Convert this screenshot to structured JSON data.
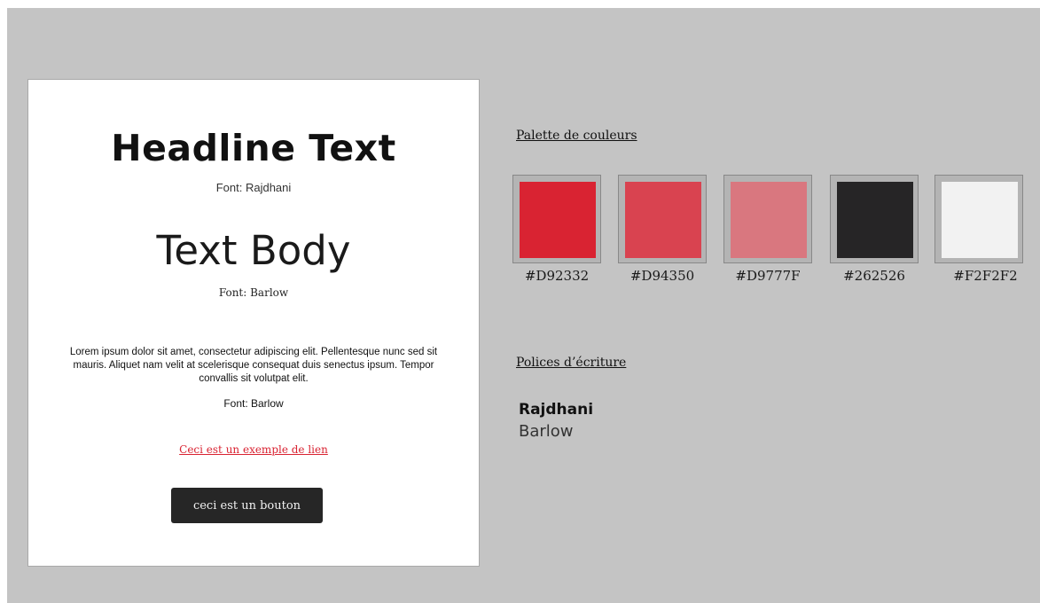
{
  "card": {
    "headline": "Headline Text",
    "headline_font_note": "Font: Rajdhani",
    "body_title": "Text Body",
    "body_font_note": "Font: Barlow",
    "lorem": "Lorem ipsum dolor sit amet, consectetur adipiscing elit. Pellentesque nunc sed sit mauris. Aliquet nam velit at scelerisque consequat duis senectus ipsum. Tempor convallis sit volutpat elit.",
    "lorem_font_note": "Font: Barlow",
    "link_text": "Ceci est un exemple de lien",
    "button_label": "ceci est un bouton"
  },
  "palette": {
    "heading": "Palette de couleurs",
    "colors": [
      {
        "hex": "#D92332",
        "label": "#D92332"
      },
      {
        "hex": "#D94350",
        "label": "#D94350"
      },
      {
        "hex": "#D9777F",
        "label": "#D9777F"
      },
      {
        "hex": "#262526",
        "label": "#262526"
      },
      {
        "hex": "#F2F2F2",
        "label": "#F2F2F2"
      }
    ]
  },
  "fonts": {
    "heading": "Polices d’écriture",
    "items": [
      "Rajdhani",
      "Barlow"
    ]
  },
  "colors": {
    "background": "#C4C4C4",
    "card": "#FFFFFF",
    "accent": "#D92332",
    "button": "#262626"
  }
}
